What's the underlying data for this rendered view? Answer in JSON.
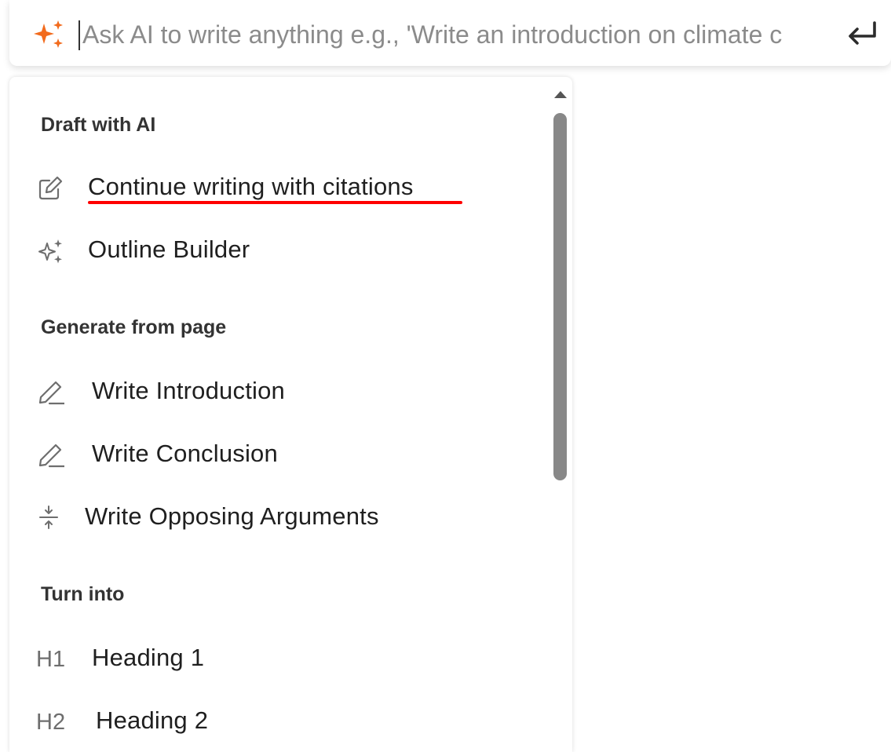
{
  "ai_input": {
    "placeholder": "Ask AI to write anything e.g., 'Write an introduction on climate c",
    "icon": "sparkle-icon",
    "submit_icon": "enter-icon",
    "accent_color": "#f26b1d"
  },
  "menu": {
    "sections": [
      {
        "title": "Draft with AI",
        "items": [
          {
            "label": "Continue writing with citations",
            "icon": "edit-pencil-square-icon",
            "highlight": "red-underline"
          },
          {
            "label": "Outline Builder",
            "icon": "sparkle-icon"
          }
        ]
      },
      {
        "title": "Generate from page",
        "items": [
          {
            "label": "Write Introduction",
            "icon": "pencil-icon"
          },
          {
            "label": "Write Conclusion",
            "icon": "pencil-icon"
          },
          {
            "label": "Write Opposing Arguments",
            "icon": "compress-arrows-icon"
          }
        ]
      },
      {
        "title": "Turn into",
        "items": [
          {
            "label": "Heading 1",
            "icon_text": "H1"
          },
          {
            "label": "Heading 2",
            "icon_text": "H2"
          }
        ]
      }
    ]
  },
  "colors": {
    "highlight_underline": "#ff0000",
    "scrollbar_thumb": "#888888"
  }
}
